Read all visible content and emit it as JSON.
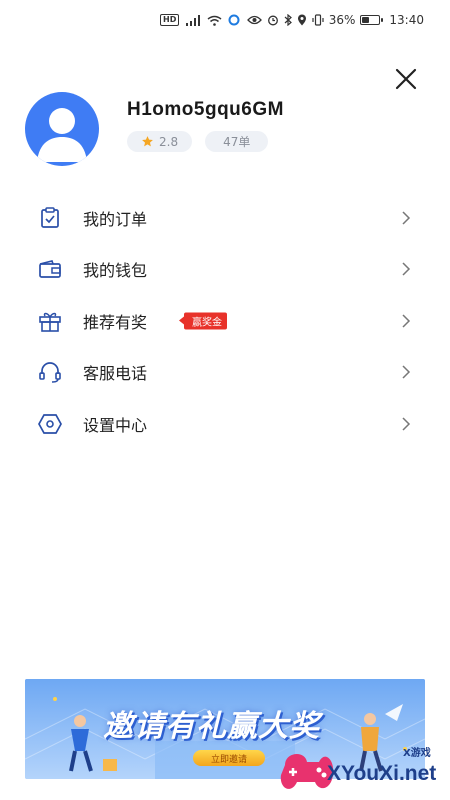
{
  "status_bar": {
    "hd": "HD",
    "battery_percent": "36%",
    "battery_level": 0.36,
    "time": "13:40"
  },
  "profile": {
    "username": "H1omo5gqu6GM",
    "rating": "2.8",
    "orders": "47单"
  },
  "menu": {
    "items": [
      {
        "label": "我的订单",
        "icon": "clipboard-check-icon"
      },
      {
        "label": "我的钱包",
        "icon": "wallet-icon"
      },
      {
        "label": "推荐有奖",
        "icon": "gift-icon",
        "tag": "赢奖金"
      },
      {
        "label": "客服电话",
        "icon": "headset-icon"
      },
      {
        "label": "设置中心",
        "icon": "settings-hexagon-icon"
      }
    ]
  },
  "banner": {
    "title": "邀请有礼赢大奖",
    "button": "立即邀请"
  },
  "watermark": {
    "text": "XYouXi.net",
    "small": "X游戏"
  },
  "colors": {
    "accent": "#3f7cf4",
    "icon_blue": "#2a4fa8",
    "promo_red": "#e8322a"
  }
}
